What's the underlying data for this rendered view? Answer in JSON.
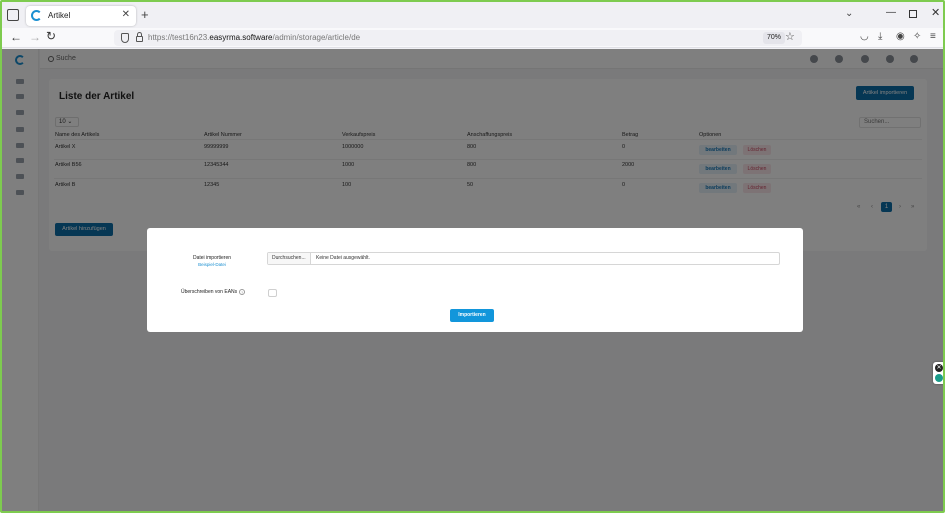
{
  "browser": {
    "tab_title": "Artikel",
    "tab_close": "✕",
    "new_tab": "+",
    "url_prefix": "https://test16n23.",
    "url_host": "easyrma.software",
    "url_path": "/admin/storage/article/de",
    "zoom": "70%"
  },
  "app": {
    "search_placeholder": "Suche"
  },
  "articles": {
    "title": "Liste der Artikel",
    "import_button": "Artikel importieren",
    "page_size": "10",
    "search_placeholder": "Suchen...",
    "columns": [
      "Name des Artikels",
      "Artikel Nummer",
      "Verkaufspreis",
      "Anschaffungspreis",
      "Betrag",
      "Optionen"
    ],
    "rows": [
      {
        "name": "Artikel X",
        "number": "99999999",
        "sale": "1000000",
        "purchase": "800",
        "amount": "0"
      },
      {
        "name": "Artikel B56",
        "number": "12345344",
        "sale": "1000",
        "purchase": "800",
        "amount": "2000"
      },
      {
        "name": "Artikel B",
        "number": "12345",
        "sale": "100",
        "purchase": "50",
        "amount": "0"
      }
    ],
    "edit_label": "bearbeiten",
    "delete_label": "Löschen",
    "pager": {
      "first": "«",
      "prev": "‹",
      "current": "1",
      "next": "›",
      "last": "»"
    },
    "add_button": "Artikel hinzufügen"
  },
  "modal": {
    "import_label": "Datei importieren",
    "sample_link": "Beispiel-Datei",
    "browse_label": "Durchsuchen...",
    "no_file": "Keine Datei ausgewählt.",
    "overwrite_label": "Überschreiben von EANs",
    "help": "?",
    "submit": "Importieren"
  },
  "colors": {
    "primary": "#0d6ea8",
    "accent": "#1296db",
    "frame": "#7ecb4f"
  }
}
